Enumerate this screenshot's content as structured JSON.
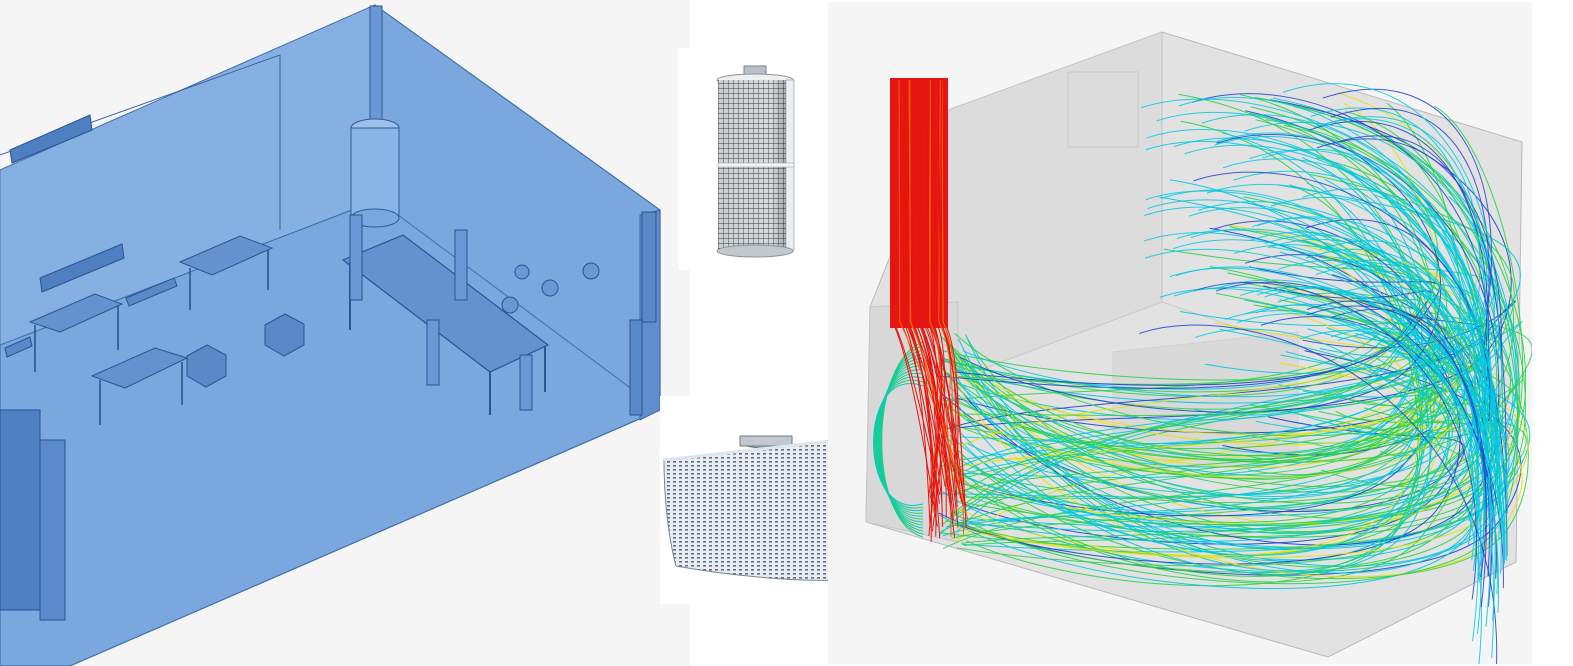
{
  "figure": {
    "panels": [
      {
        "id": "room-geometry",
        "kind": "3d-cad-render",
        "color": "#6f9fd8"
      },
      {
        "id": "cylindrical-diffuser",
        "kind": "product-render",
        "color": "#9aa0a6"
      },
      {
        "id": "wall-diffuser",
        "kind": "product-render",
        "color": "#c9d2de"
      },
      {
        "id": "streamlines",
        "kind": "cfd-streamline-render",
        "colormap": [
          "#1e3fd0",
          "#00c8e0",
          "#29d24a",
          "#e8e000",
          "#ff0000"
        ]
      }
    ]
  }
}
